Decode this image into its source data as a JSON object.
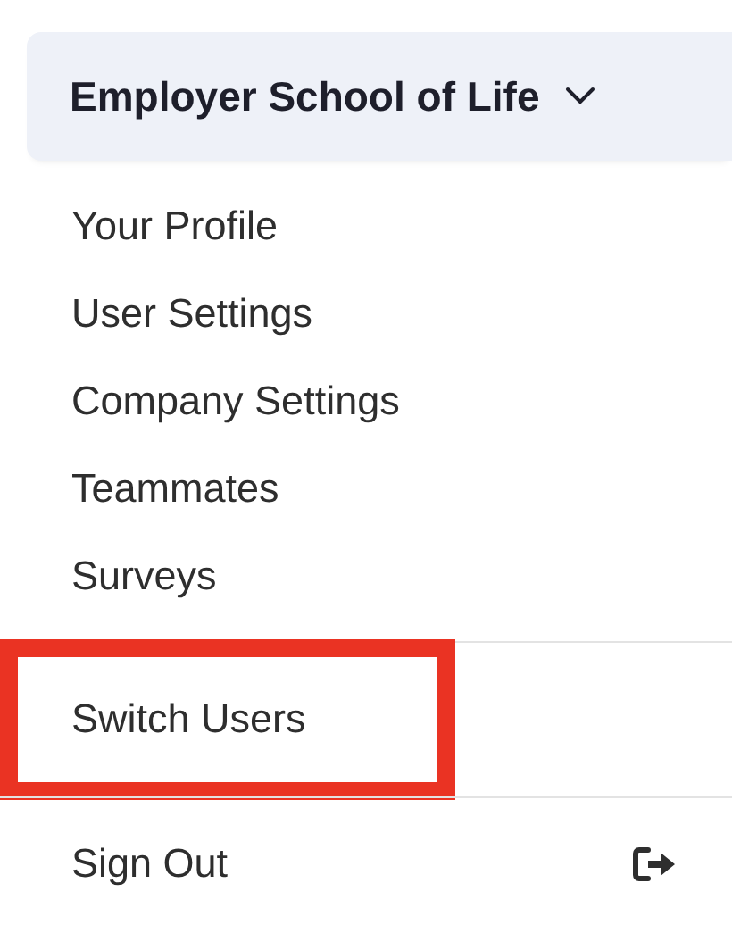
{
  "account_button": {
    "label": "Employer School of Life",
    "expanded": true
  },
  "menu_sections": [
    {
      "items": [
        {
          "label": "Your Profile",
          "highlighted": false
        },
        {
          "label": "User Settings",
          "highlighted": false
        },
        {
          "label": "Company Settings",
          "highlighted": false
        },
        {
          "label": "Teammates",
          "highlighted": false
        },
        {
          "label": "Surveys",
          "highlighted": false
        }
      ]
    },
    {
      "items": [
        {
          "label": "Switch Users",
          "highlighted": true
        }
      ]
    },
    {
      "items": [
        {
          "label": "Sign Out",
          "highlighted": false,
          "kind": "sign-out"
        }
      ]
    }
  ]
}
